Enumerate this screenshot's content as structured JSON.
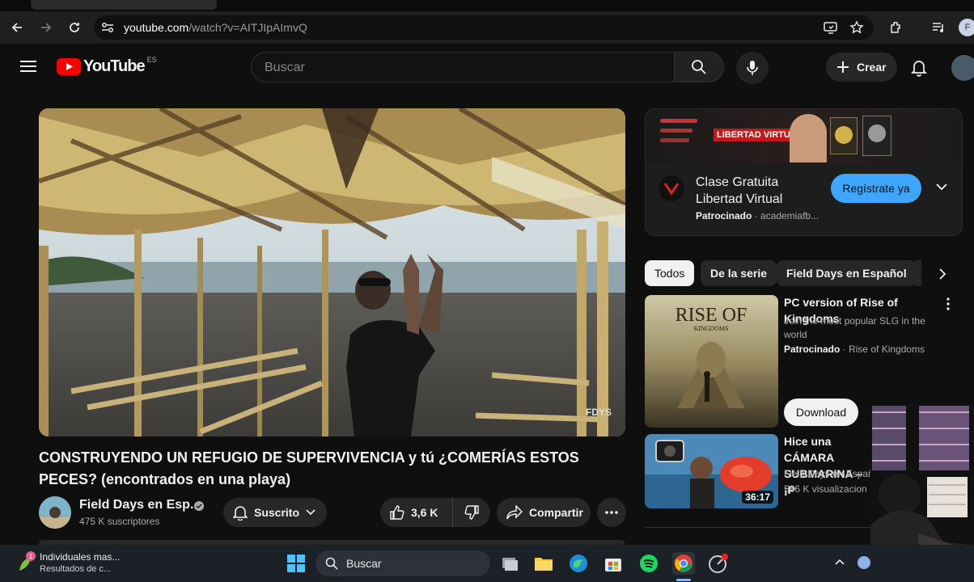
{
  "browser": {
    "url_host": "youtube.com",
    "url_path": "/watch?v=AITJIpAImvQ",
    "profile_initial": "F"
  },
  "header": {
    "logo_text": "YouTube",
    "region": "ES",
    "search_placeholder": "Buscar",
    "create_label": "Crear"
  },
  "video": {
    "title": "CONSTRUYENDO UN REFUGIO DE SUPERVIVENCIA y tú ¿COMERÍAS ESTOS PECES? (encontrados en una playa)",
    "watermark": "FDYS",
    "channel_name": "Field Days en Esp...",
    "subscribers": "475 K suscriptores",
    "subscribed_label": "Suscrito",
    "likes": "3,6 K",
    "share_label": "Compartir"
  },
  "ad": {
    "banner_text": "LIBERTAD VIRTUAL",
    "title_line1": "Clase Gratuita",
    "title_line2": "Libertad Virtual",
    "sponsored": "Patrocinado",
    "advertiser": "academiafb...",
    "cta": "Regístrate ya"
  },
  "chips": [
    "Todos",
    "De la serie",
    "Field Days en Español"
  ],
  "recommendations": [
    {
      "title": "PC version of Rise of Kingdoms",
      "description_line1": "Join the most popular SLG in the",
      "description_line2": "world",
      "sponsored": "Patrocinado",
      "advertiser": "Rise of Kingdoms",
      "thumb_title": "RISE OF",
      "thumb_subtitle": "KINGDOMS",
      "button": "Download"
    },
    {
      "title_line1": "Hice una CÁMARA",
      "title_line2": "SUBMARINA – ¡P",
      "channel": "Field Days en Españ",
      "views": "586 K visualizacion",
      "duration": "36:17"
    }
  ],
  "taskbar": {
    "notification_title": "Individuales mas...",
    "notification_sub": "Resultados de c...",
    "search_label": "Buscar"
  },
  "colors": {
    "background": "#0f0f0f",
    "youtube_red": "#ff0000",
    "cta_blue": "#3ea6ff"
  }
}
